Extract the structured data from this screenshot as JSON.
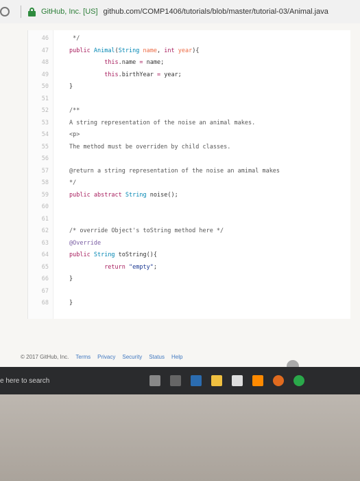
{
  "browser": {
    "site_name": "GitHub, Inc. [US]",
    "url": "github.com/COMP1406/tutorials/blob/master/tutorial-03/Animal.java"
  },
  "code": {
    "lines": [
      {
        "n": "46",
        "html": "<span class='cm'> */</span>"
      },
      {
        "n": "47",
        "html": "<span class='kw'>public</span> <span class='ty'>Animal</span>(<span class='ty'>String</span> <span class='pm'>name</span>, <span class='kw'>int</span> <span class='pm'>year</span>){"
      },
      {
        "n": "48",
        "html": "          <span class='kw'>this</span>.name <span class='kw'>=</span> name;"
      },
      {
        "n": "49",
        "html": "          <span class='kw'>this</span>.birthYear <span class='kw'>=</span> year;"
      },
      {
        "n": "50",
        "html": "}"
      },
      {
        "n": "51",
        "html": ""
      },
      {
        "n": "52",
        "html": "<span class='cm'>/**</span>"
      },
      {
        "n": "53",
        "html": "<span class='cm'>A string representation of the noise an animal makes.</span>"
      },
      {
        "n": "54",
        "html": "<span class='cm'>&lt;p&gt;</span>"
      },
      {
        "n": "55",
        "html": "<span class='cm'>The method must be overriden by child classes.</span>"
      },
      {
        "n": "56",
        "html": ""
      },
      {
        "n": "57",
        "html": "<span class='cm'>@return a string representation of the noise an amimal makes</span>"
      },
      {
        "n": "58",
        "html": "<span class='cm'>*/</span>"
      },
      {
        "n": "59",
        "html": "<span class='kw'>public</span> <span class='kw'>abstract</span> <span class='ty'>String</span> noise();"
      },
      {
        "n": "60",
        "html": ""
      },
      {
        "n": "61",
        "html": ""
      },
      {
        "n": "62",
        "html": "<span class='cm'>/* override Object's toString method here */</span>"
      },
      {
        "n": "63",
        "html": "<span class='an'>@Override</span>"
      },
      {
        "n": "64",
        "html": "<span class='kw'>public</span> <span class='ty'>String</span> toString(){"
      },
      {
        "n": "65",
        "html": "          <span class='kw'>return</span> <span class='str'>\"empty\"</span>;"
      },
      {
        "n": "66",
        "html": "}"
      },
      {
        "n": "67",
        "html": ""
      },
      {
        "n": "68",
        "html": "}"
      }
    ]
  },
  "footer": {
    "copyright": "© 2017 GitHub, Inc.",
    "links": [
      "Terms",
      "Privacy",
      "Security",
      "Status",
      "Help"
    ]
  },
  "taskbar": {
    "search_placeholder": "e here to search"
  }
}
